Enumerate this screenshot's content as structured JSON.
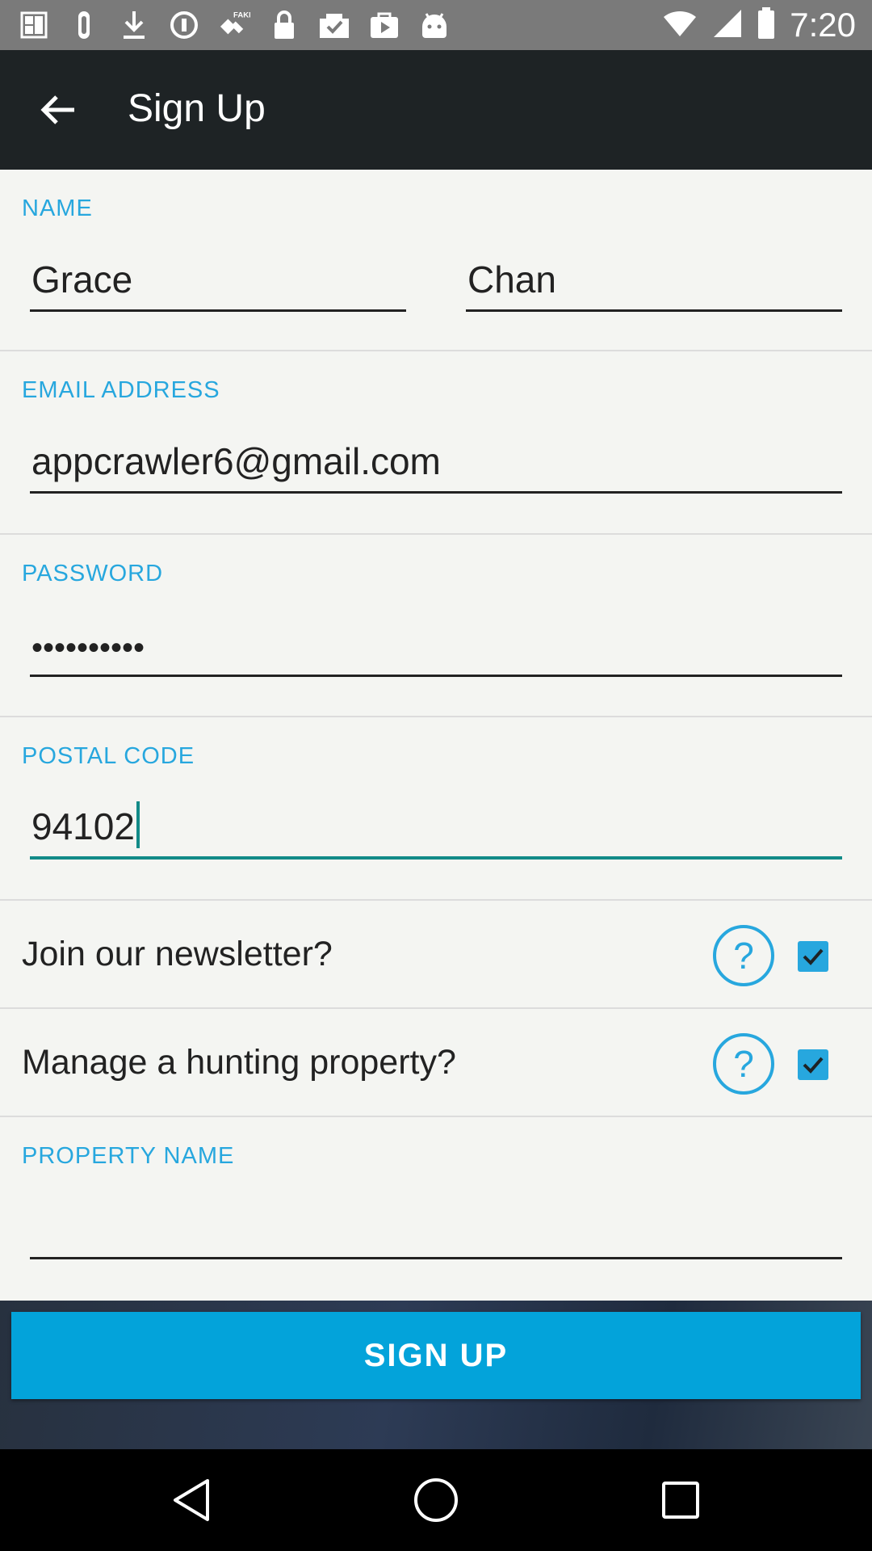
{
  "status_bar": {
    "icons": [
      "notification-icon",
      "clip-icon",
      "download-icon",
      "data-saver-icon",
      "satellite-fake-icon",
      "lock-icon",
      "tasks-icon",
      "play-store-icon",
      "android-icon",
      "wifi-icon",
      "signal-icon",
      "battery-icon"
    ],
    "fake_badge": "FAKE",
    "time": "7:20"
  },
  "app_bar": {
    "title": "Sign Up",
    "back_icon": "arrow-back-icon"
  },
  "form": {
    "name_label": "NAME",
    "first_name": "Grace",
    "last_name": "Chan",
    "email_label": "EMAIL ADDRESS",
    "email": "appcrawler6@gmail.com",
    "password_label": "PASSWORD",
    "password_mask": "••••••••••",
    "postal_label": "POSTAL CODE",
    "postal_code": "94102",
    "newsletter_question": "Join our newsletter?",
    "newsletter_checked": true,
    "hunting_question": "Manage a hunting property?",
    "hunting_checked": true,
    "help_symbol": "?",
    "property_label": "PROPERTY NAME",
    "property_name": ""
  },
  "actions": {
    "signup_label": "SIGN UP"
  },
  "colors": {
    "accent": "#27a7de",
    "button": "#03a3da",
    "active_underline": "#128b88",
    "app_bar": "#1e2325"
  }
}
